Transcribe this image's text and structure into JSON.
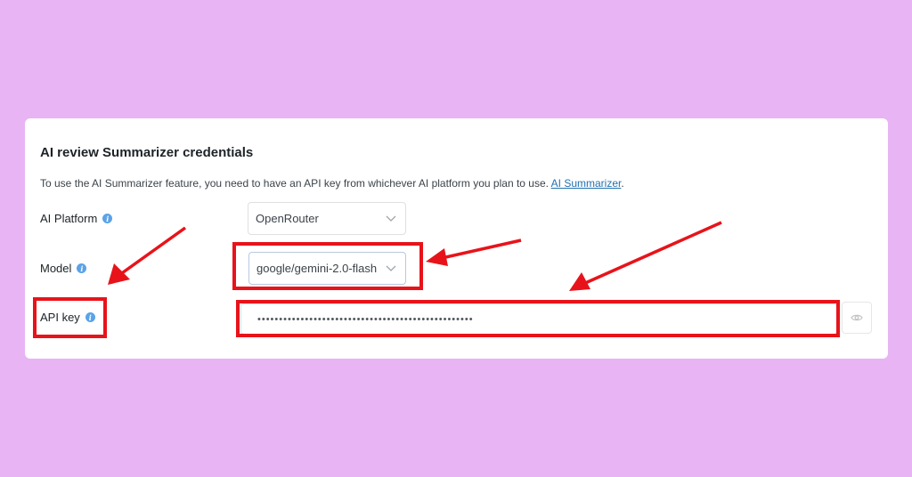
{
  "card": {
    "title": "AI review Summarizer credentials",
    "description": "To use the AI Summarizer feature, you need to have an API key from whichever AI platform you plan to use.",
    "description_link": "AI Summarizer",
    "description_end": "."
  },
  "fields": {
    "platform": {
      "label": "AI Platform",
      "value": "OpenRouter",
      "icon": "info-icon"
    },
    "model": {
      "label": "Model",
      "value": "google/gemini-2.0-flash",
      "icon": "info-icon"
    },
    "api_key": {
      "label": "API key",
      "value": "••••••••••••••••••••••••••••••••••••••••••••••••••",
      "icon": "info-icon"
    }
  },
  "colors": {
    "background": "#e8b4f4",
    "annotation": "#e8131a",
    "link": "#2271b1",
    "info": "#5aa3e8"
  }
}
